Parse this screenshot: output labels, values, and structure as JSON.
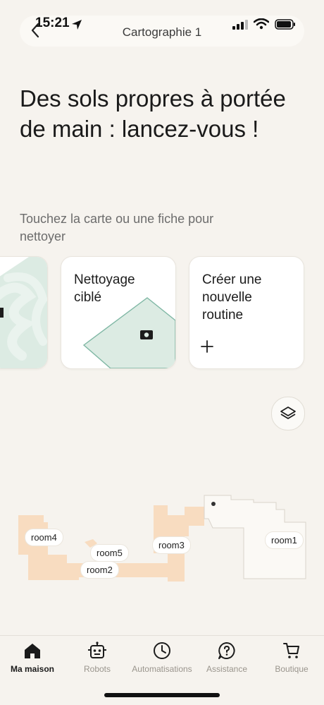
{
  "status_bar": {
    "time": "15:21"
  },
  "header": {
    "title": "Cartographie 1"
  },
  "hero": {
    "title": "Des sols propres à portée de main : lancez-vous !",
    "subtitle": "Touchez la carte ou une fiche pour nettoyer"
  },
  "cards": [
    {
      "label": ""
    },
    {
      "label": "Nettoyage ciblé"
    },
    {
      "label": "Créer une nouvelle routine"
    }
  ],
  "map": {
    "rooms": [
      "room4",
      "room5",
      "room2",
      "room3",
      "room1"
    ]
  },
  "tabs": [
    {
      "label": "Ma maison",
      "icon": "house-icon",
      "active": true
    },
    {
      "label": "Robots",
      "icon": "robot-icon",
      "active": false
    },
    {
      "label": "Automatisations",
      "icon": "clock-icon",
      "active": false
    },
    {
      "label": "Assistance",
      "icon": "help-icon",
      "active": false
    },
    {
      "label": "Boutique",
      "icon": "cart-icon",
      "active": false
    }
  ],
  "colors": {
    "background": "#f6f3ee",
    "room_fill": "#f8dcc0",
    "room1_fill": "#fbf9f5",
    "zone_fill": "#dcebe3",
    "zone_stroke": "#7fb7a4"
  }
}
